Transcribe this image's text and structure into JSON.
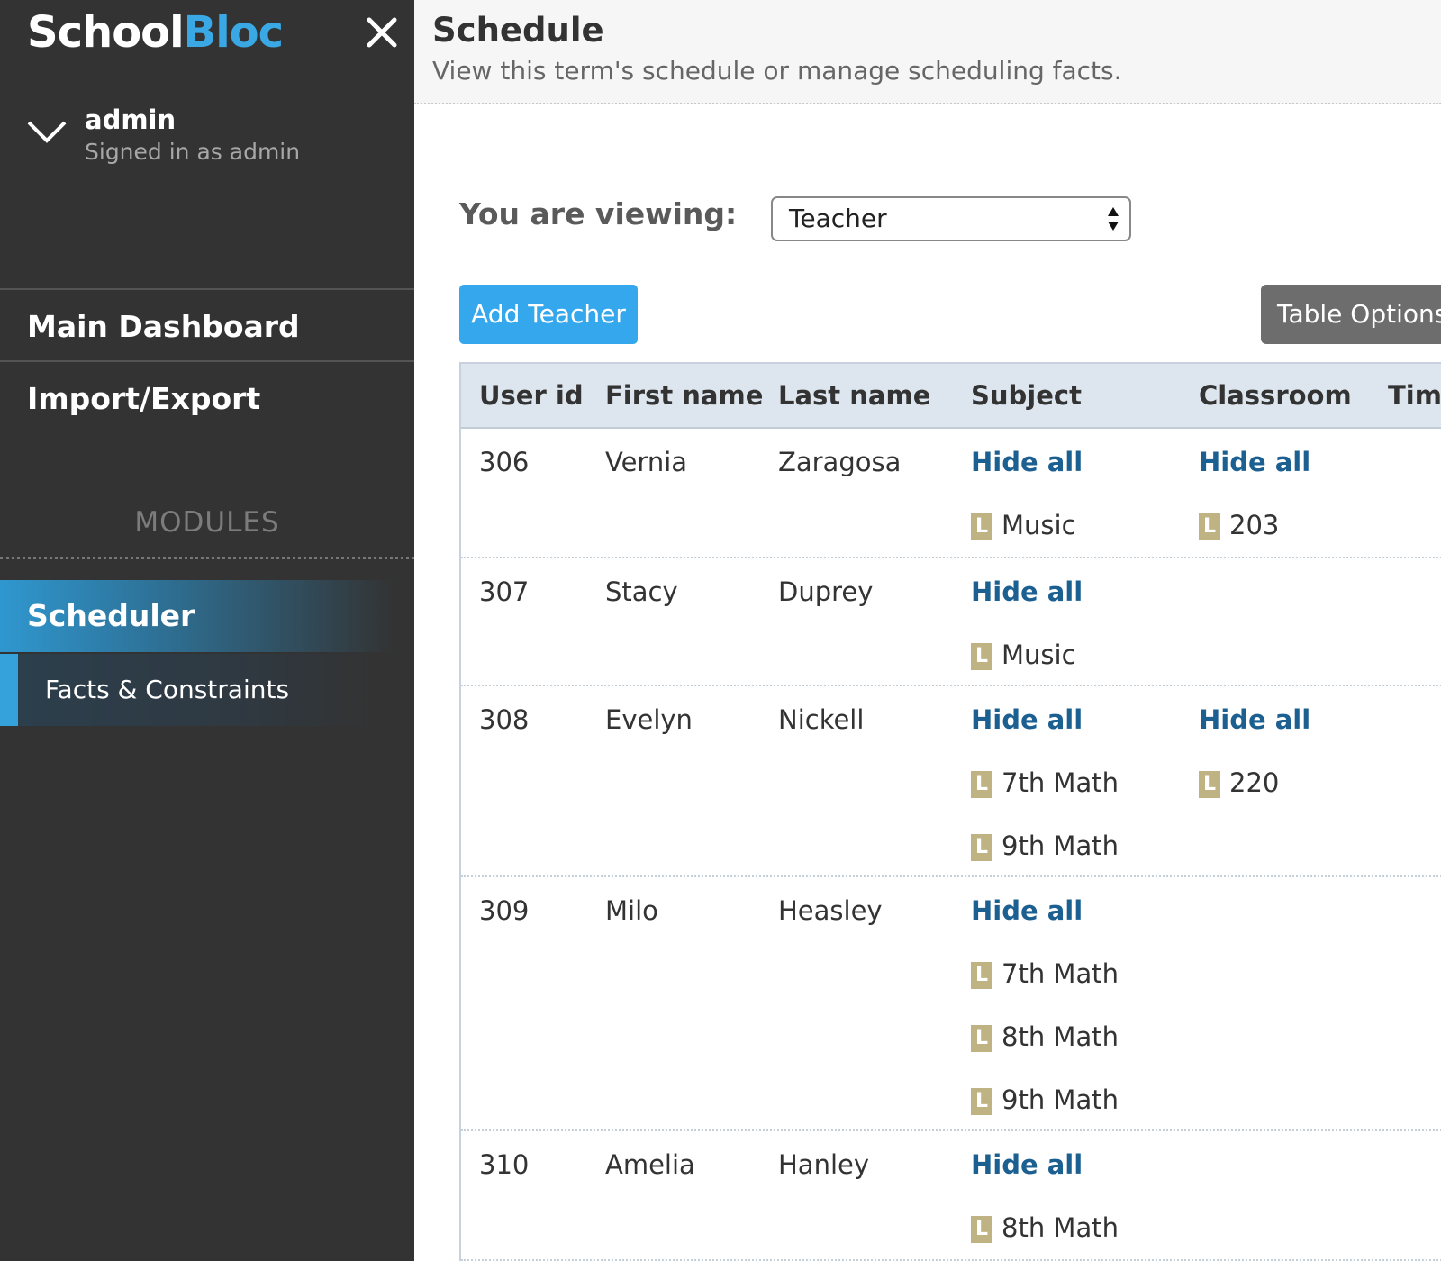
{
  "app": {
    "logo_part1": "School",
    "logo_part2": "Bloc",
    "brand_color": "#3ba8e6",
    "sidebar_bg": "#333333"
  },
  "user": {
    "name": "admin",
    "status": "Signed in as admin"
  },
  "nav": {
    "main_dashboard": "Main Dashboard",
    "import_export": "Import/Export",
    "modules_heading": "MODULES",
    "scheduler": "Scheduler",
    "facts_constraints": "Facts & Constraints"
  },
  "header": {
    "title": "Schedule",
    "subtitle": "View this term's schedule or manage scheduling facts."
  },
  "viewing": {
    "label": "You are viewing:",
    "selected": "Teacher"
  },
  "buttons": {
    "add": "Add Teacher",
    "table_options": "Table Options"
  },
  "table": {
    "columns": [
      "User id",
      "First name",
      "Last name",
      "Subject",
      "Classroom",
      "Time"
    ],
    "hide_all_label": "Hide all",
    "tag_letter": "L",
    "rows": [
      {
        "id": "306",
        "first": "Vernia",
        "last": "Zaragosa",
        "subjects": [
          "Music"
        ],
        "classrooms": [
          "203"
        ]
      },
      {
        "id": "307",
        "first": "Stacy",
        "last": "Duprey",
        "subjects": [
          "Music"
        ],
        "classrooms": []
      },
      {
        "id": "308",
        "first": "Evelyn",
        "last": "Nickell",
        "subjects": [
          "7th Math",
          "9th Math"
        ],
        "classrooms": [
          "220"
        ]
      },
      {
        "id": "309",
        "first": "Milo",
        "last": "Heasley",
        "subjects": [
          "7th Math",
          "8th Math",
          "9th Math"
        ],
        "classrooms": []
      },
      {
        "id": "310",
        "first": "Amelia",
        "last": "Hanley",
        "subjects": [
          "8th Math"
        ],
        "classrooms": []
      }
    ]
  }
}
